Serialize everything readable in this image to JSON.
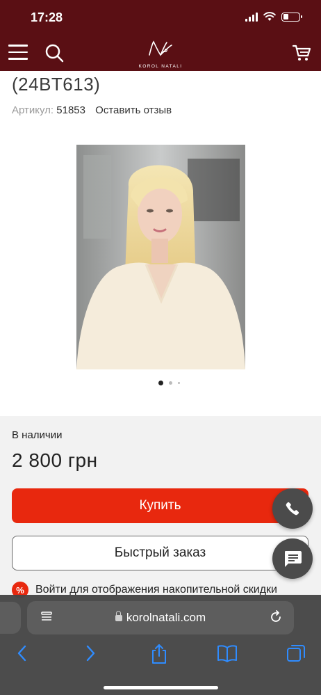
{
  "status_bar": {
    "time": "17:28"
  },
  "header": {
    "logo_text": "KOROL NATALI",
    "icons": [
      "menu-icon",
      "search-icon",
      "cart-icon"
    ]
  },
  "product": {
    "title": "(24BT613)",
    "sku_label": "Артикул:",
    "sku": "51853",
    "review_link": "Оставить отзыв",
    "image_count": 3,
    "active_image": 1
  },
  "purchase": {
    "stock": "В наличии",
    "price": "2 800 грн",
    "buy_label": "Купить",
    "quick_order_label": "Быстрый заказ",
    "discount_badge": "%",
    "discount_text": "Войти для отображения накопительной скидки"
  },
  "floating": {
    "icons": [
      "phone-icon",
      "chat-icon"
    ]
  },
  "browser": {
    "url": "korolnatali.com",
    "toolbar_icons": [
      "back-icon",
      "forward-icon",
      "share-icon",
      "bookmarks-icon",
      "tabs-icon"
    ]
  },
  "colors": {
    "header_bg": "#5a0f14",
    "buy_button": "#e8280e",
    "panel_bg": "#f2f2f2",
    "fab_bg": "#4b4b4b",
    "browser_bar": "#464646",
    "safari_blue": "#2f8cff"
  }
}
